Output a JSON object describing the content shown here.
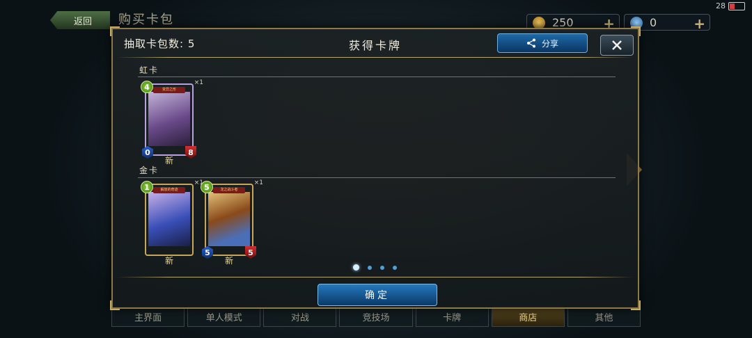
{
  "background": {
    "back_label": "返回",
    "title": "购买卡包",
    "currency": [
      {
        "value": "250",
        "icon": "gold-coin-icon",
        "plus": "+"
      },
      {
        "value": "0",
        "icon": "crystal-icon",
        "plus": "+"
      }
    ],
    "status": {
      "battery": "28"
    },
    "nav": [
      {
        "label": "主界面",
        "active": false
      },
      {
        "label": "单人模式",
        "active": false
      },
      {
        "label": "对战",
        "active": false
      },
      {
        "label": "竞技场",
        "active": false
      },
      {
        "label": "卡牌",
        "active": false
      },
      {
        "label": "商店",
        "active": true
      },
      {
        "label": "其他",
        "active": false
      }
    ]
  },
  "modal": {
    "draw_count_label": "抽取卡包数: 5",
    "title": "获得卡牌",
    "share_label": "分享",
    "close_icon": "close-icon",
    "confirm_label": "确定",
    "page_dots": {
      "count": 4,
      "active_index": 0
    },
    "sections": [
      {
        "label": "虹卡",
        "cards": [
          {
            "name": "变异之形",
            "cost": "4",
            "attack": "0",
            "defense": "8",
            "qty": "×1",
            "new": "新",
            "art": [
              "#6a4a8a",
              "#c3b4d8"
            ]
          }
        ]
      },
      {
        "label": "金卡",
        "cards": [
          {
            "name": "解放的奇迹",
            "cost": "1",
            "attack": "",
            "defense": "",
            "qty": "×1",
            "new": "新",
            "art": [
              "#3a4fb8",
              "#c7b0e8"
            ]
          },
          {
            "name": "龙之战斗者",
            "cost": "5",
            "attack": "5",
            "defense": "5",
            "qty": "×1",
            "new": "新",
            "art": [
              "#8a4a1a",
              "#4a6fb8"
            ]
          }
        ]
      }
    ]
  },
  "colors": {
    "accent_gold": "#c9a75a",
    "button_blue": "#1e6aa8"
  }
}
